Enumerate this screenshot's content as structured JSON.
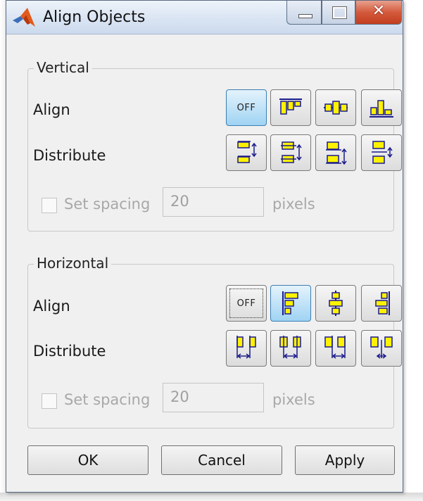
{
  "window": {
    "title": "Align Objects"
  },
  "vertical": {
    "legend": "Vertical",
    "align_label": "Align",
    "distribute_label": "Distribute",
    "off_label": "OFF",
    "spacing_label": "Set spacing",
    "spacing_value": "20",
    "spacing_unit": "pixels"
  },
  "horizontal": {
    "legend": "Horizontal",
    "align_label": "Align",
    "distribute_label": "Distribute",
    "off_label": "OFF",
    "spacing_label": "Set spacing",
    "spacing_value": "20",
    "spacing_unit": "pixels"
  },
  "buttons": {
    "ok": "OK",
    "cancel": "Cancel",
    "apply": "Apply"
  },
  "colors": {
    "icon_fill": "#fff200",
    "icon_stroke": "#1a1a8c",
    "active_button": "#9fd3f3",
    "close_button": "#c84a2c"
  }
}
